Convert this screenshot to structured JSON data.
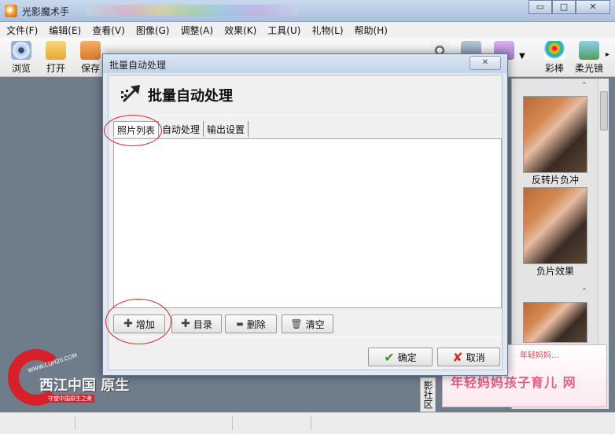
{
  "app": {
    "title": "光影魔术手"
  },
  "window_controls": {
    "minimize": "▭",
    "maximize": "□",
    "close": "✕"
  },
  "menu": [
    "文件(F)",
    "编辑(E)",
    "查看(V)",
    "图像(G)",
    "调整(A)",
    "效果(K)",
    "工具(U)",
    "礼物(L)",
    "帮助(H)"
  ],
  "toolbar": {
    "items": [
      {
        "label": "浏览",
        "icon": "eye-icon"
      },
      {
        "label": "打开",
        "icon": "folder-icon"
      },
      {
        "label": "保存",
        "icon": "floppy-icon"
      }
    ],
    "right_items": [
      {
        "label": "彩棒",
        "icon": "magic-wand-icon"
      },
      {
        "label": "柔光镜",
        "icon": "soft-light-icon"
      }
    ],
    "more": "▸"
  },
  "right_panel": {
    "items": [
      {
        "label": "反转片负冲"
      },
      {
        "label": "负片效果"
      }
    ],
    "scroll_up": "⌃"
  },
  "side_tab": "影社区",
  "banner": {
    "top_text": "年轻妈妈…",
    "main_text": "年轻妈妈孩子育儿 网"
  },
  "watermark": {
    "url": "WWW.CQH20.COM",
    "text": "西江中国 原生",
    "sub": "守望中国原生之美"
  },
  "dialog": {
    "title": "批量自动处理",
    "heading": "批量自动处理",
    "close": "✕",
    "tabs": [
      "照片列表",
      "自动处理",
      "输出设置"
    ],
    "active_tab": 0,
    "actions": [
      {
        "label": "增加",
        "glyph": "✚"
      },
      {
        "label": "目录",
        "glyph": "✚"
      },
      {
        "label": "删除",
        "glyph": "▬"
      },
      {
        "label": "清空",
        "glyph": "🗑"
      }
    ],
    "ok": "确定",
    "cancel": "取消"
  }
}
